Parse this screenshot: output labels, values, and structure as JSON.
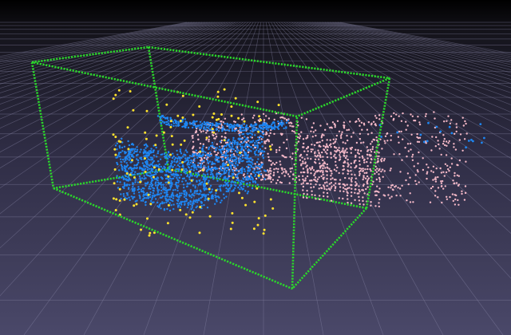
{
  "scene": {
    "background_top": "#000000",
    "background_bottom": "#4a4869",
    "grid_color": "#8a87a8",
    "bounding_box_color": "#2bd62b",
    "clusters": [
      {
        "name": "blue-cluster",
        "color": "#1e86f2"
      },
      {
        "name": "pink-cluster",
        "color": "#f2b7c6"
      },
      {
        "name": "yellow-points",
        "color": "#ffe22e"
      }
    ]
  }
}
